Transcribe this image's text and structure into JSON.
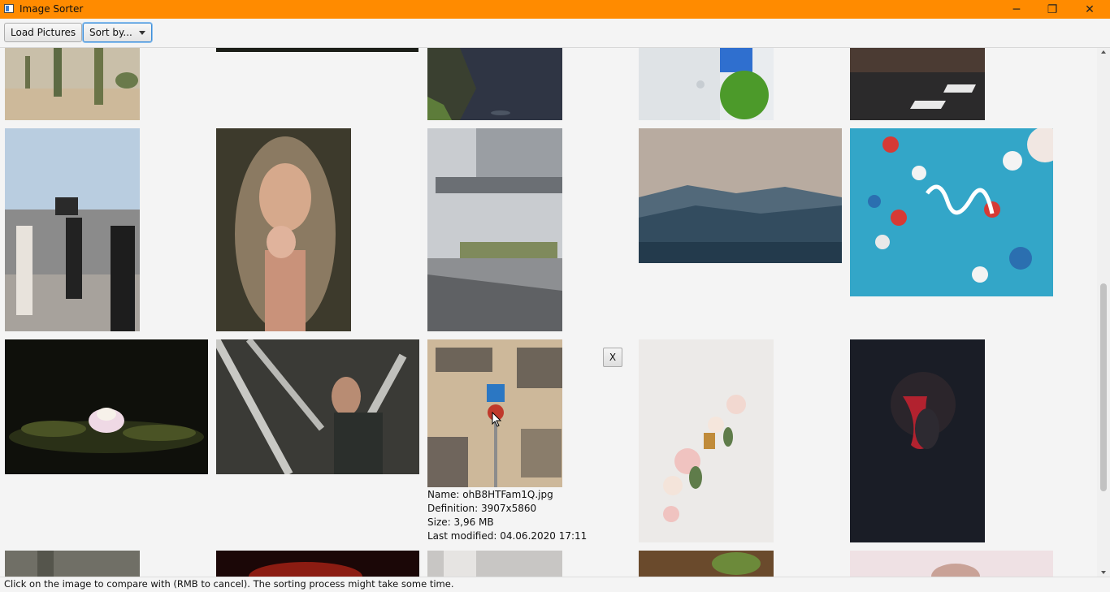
{
  "window": {
    "title": "Image Sorter",
    "accent_color": "#ff8b00",
    "controls": {
      "minimize": "─",
      "maximize": "❐",
      "close": "✕"
    }
  },
  "toolbar": {
    "load_label": "Load Pictures",
    "sort_label": "Sort by..."
  },
  "gallery": {
    "cancel_button": "X",
    "selected_info": {
      "name": "Name: ohB8HTFam1Q.jpg",
      "definition": "Definition: 3907x5860",
      "size": "Size: 3,96 MB",
      "modified": "Last modified: 04.06.2020 17:11"
    }
  },
  "status": {
    "text": "Click on the image to compare with (RMB to cancel). The sorting process might take some time."
  }
}
